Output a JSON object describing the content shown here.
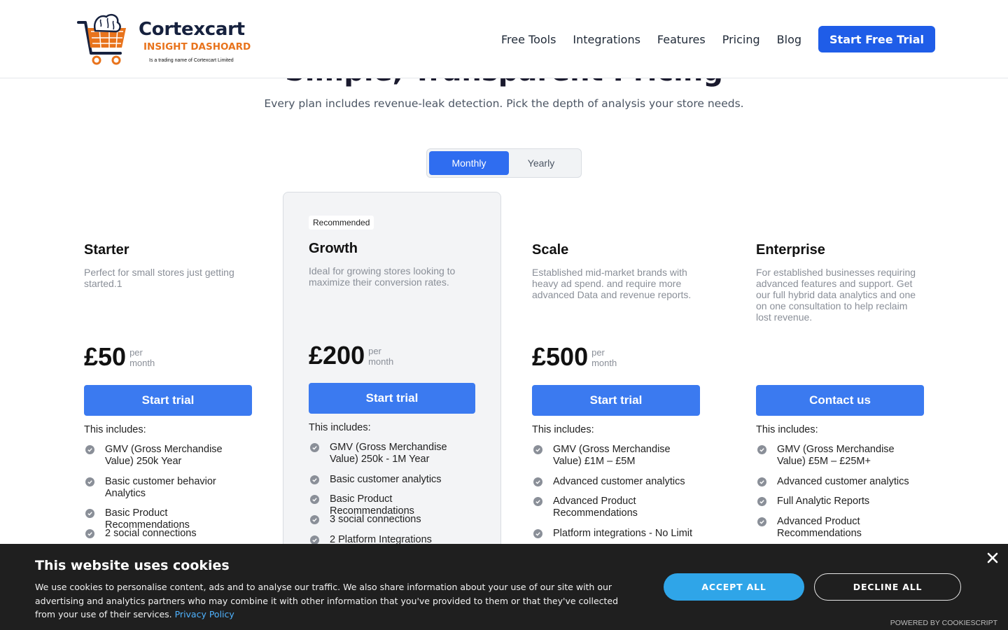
{
  "brand": {
    "name": "Cortexcart",
    "product": "INSIGHT DASHOARD",
    "tagline": "Is a trading name of Cortexcart Limited"
  },
  "nav": {
    "links": [
      "Free Tools",
      "Integrations",
      "Features",
      "Pricing",
      "Blog"
    ],
    "cta": "Start Free Trial"
  },
  "hero": {
    "title": "Simple, Transparent Pricing",
    "subtitle": "Every plan includes revenue-leak detection. Pick the depth of analysis your store needs."
  },
  "billing_toggle": {
    "options": [
      "Monthly",
      "Yearly"
    ],
    "selected": "Monthly"
  },
  "plans": [
    {
      "name": "Starter",
      "description": "Perfect for small stores just getting started.1",
      "price": "£50",
      "per_line1": "per",
      "per_line2": "month",
      "cta": "Start trial",
      "includes_label": "This includes:",
      "features": [
        "GMV (Gross Merchandise Value) 250k Year",
        "Basic customer behavior Analytics",
        "Basic Product Recommendations",
        "2 social connections"
      ]
    },
    {
      "name": "Growth",
      "badge": "Recommended",
      "description": "Ideal for growing stores looking to maximize their conversion rates.",
      "price": "£200",
      "per_line1": "per",
      "per_line2": "month",
      "cta": "Start trial",
      "includes_label": "This includes:",
      "features": [
        "GMV (Gross Merchandise Value) 250k - 1M Year",
        "Basic customer analytics",
        "Basic Product Recommendations",
        "3 social connections",
        "2 Platform Integrations"
      ]
    },
    {
      "name": "Scale",
      "description": "Established mid-market brands with heavy ad spend. and require more advanced Data and revenue reports.",
      "price": "£500",
      "per_line1": "per",
      "per_line2": "month",
      "cta": "Start trial",
      "includes_label": "This includes:",
      "features": [
        "GMV (Gross Merchandise Value) £1M – £5M",
        "Advanced customer analytics",
        "Advanced Product Recommendations",
        "Platform integrations - No Limit"
      ]
    },
    {
      "name": "Enterprise",
      "description": "For established businesses requiring advanced features and support. Get our full hybrid data analytics and one on one consultation to help reclaim lost revenue.",
      "cta": "Contact us",
      "includes_label": "This includes:",
      "features": [
        "GMV (Gross Merchandise Value) £5M – £25M+",
        "Advanced customer analytics",
        "Full Analytic Reports",
        "Advanced Product Recommendations"
      ]
    }
  ],
  "cookie_banner": {
    "title": "This website uses cookies",
    "text": "We use cookies to personalise content, ads and to analyse our traffic. We also share information about your use of our site with our advertising and analytics partners who may combine it with other information that you've provided to them or that they've collected from your use of their services.",
    "link": "Privacy Policy",
    "accept": "ACCEPT ALL",
    "decline": "DECLINE ALL",
    "powered_by": "POWERED BY COOKIESCRIPT"
  },
  "colors": {
    "primary": "#1f5de8",
    "cta": "#3b7af0",
    "accept": "#2fa5e8",
    "brand_orange": "#e8731c",
    "brand_navy": "#16213e",
    "banner_bg": "#1f1f1f"
  }
}
